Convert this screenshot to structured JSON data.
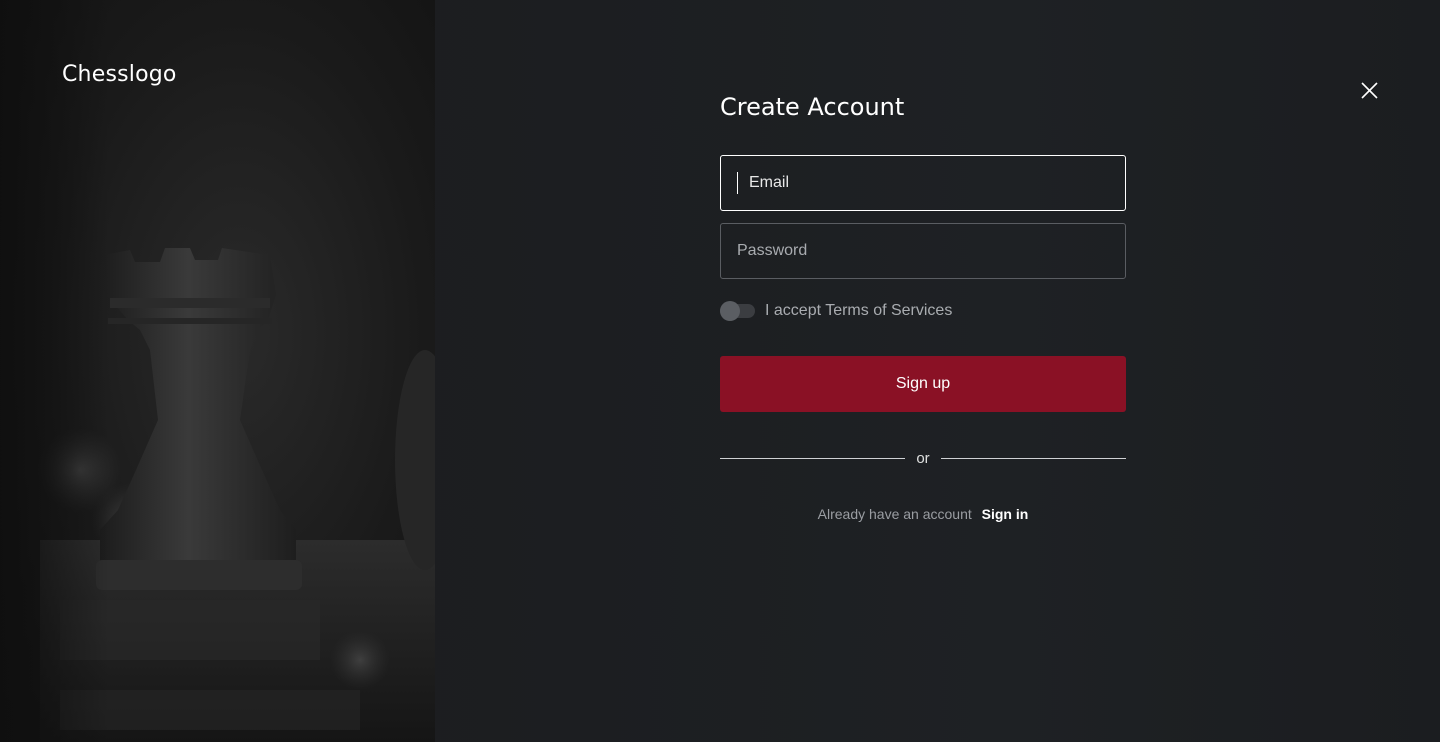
{
  "brand": {
    "logo_text": "Chesslogo"
  },
  "icons": {
    "close": "close-icon",
    "hero": "chess-rook-icon"
  },
  "form": {
    "title": "Create Account",
    "email": {
      "placeholder": "Email",
      "value": ""
    },
    "password": {
      "placeholder": "Password",
      "value": ""
    },
    "terms": {
      "label": "I accept Terms of Services",
      "checked": false
    },
    "signup_label": "Sign up",
    "divider_text": "or",
    "signin_prompt": "Already have an account",
    "signin_link": "Sign in"
  },
  "colors": {
    "accent": "#8a1125",
    "background": "#1c1e21",
    "muted_text": "#a9acb0"
  }
}
